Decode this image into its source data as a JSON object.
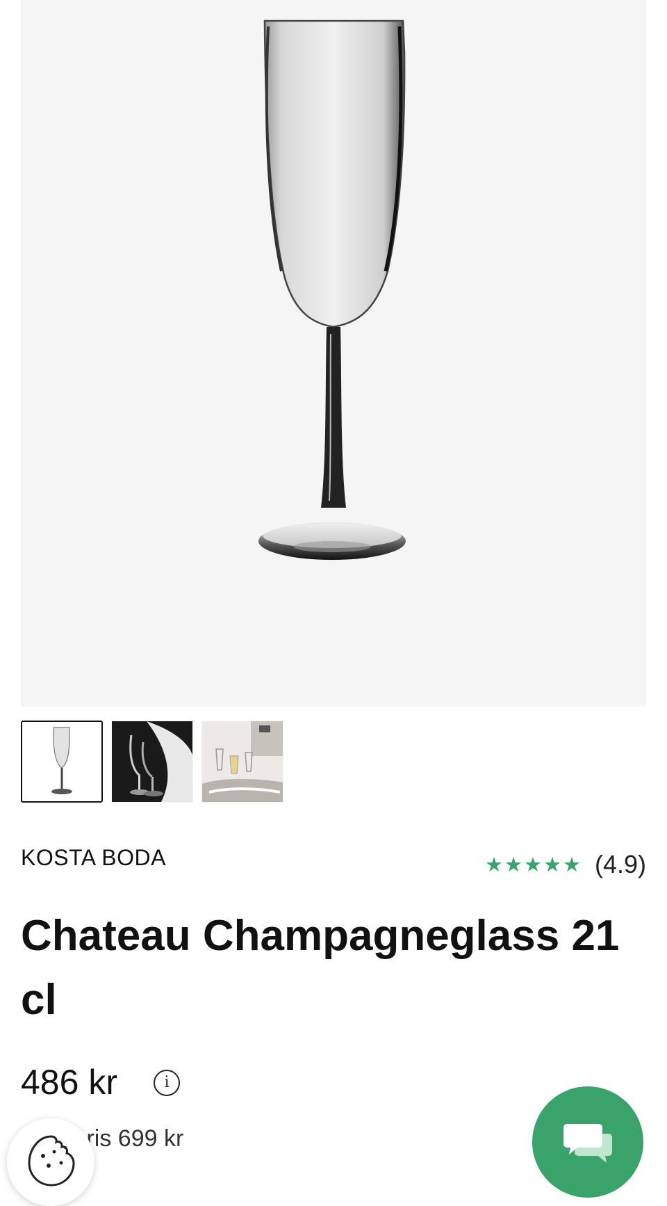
{
  "product": {
    "brand": "KOSTA BODA",
    "title": "Chateau Champagneglass 21 cl",
    "stars": "★★★★★",
    "rating_text": "(4.9)",
    "rating_value": 4.9,
    "price": "486 kr",
    "original_price": "Ord. pris 699 kr"
  },
  "gallery": {
    "thumbnail_count": 3,
    "active_index": 0
  },
  "icons": {
    "info": "info-icon",
    "cookie": "cookie-icon",
    "chat": "chat-icon"
  },
  "colors": {
    "accent": "#3aa36b",
    "hero_background": "#f5f5f5",
    "text": "#111111"
  }
}
